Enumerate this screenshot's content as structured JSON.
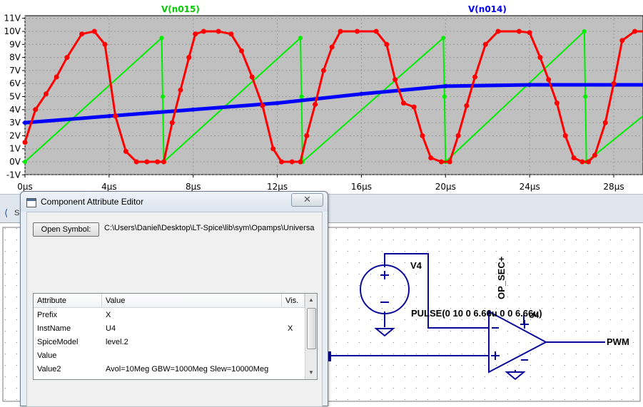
{
  "chart_data": {
    "type": "line",
    "series": [
      {
        "name": "V(n015)",
        "color": "#00ee00",
        "x": [
          0,
          6.5,
          6.55,
          6.6,
          13.1,
          13.15,
          13.2,
          19.9,
          19.95,
          20.0,
          26.6,
          26.65,
          26.7,
          30
        ],
        "y": [
          0,
          9.5,
          5,
          0,
          9.5,
          5,
          0,
          9.5,
          5,
          0,
          10,
          5,
          0,
          4.3
        ]
      },
      {
        "name": "V(n014)",
        "color": "#0000ff",
        "x": [
          0,
          4,
          8,
          12,
          16,
          20,
          24,
          28,
          30
        ],
        "y": [
          3.0,
          3.5,
          4.0,
          4.5,
          5.2,
          5.8,
          5.9,
          5.9,
          5.9
        ]
      },
      {
        "name": "",
        "color": "#ff0000",
        "x": [
          0,
          0.5,
          1.0,
          1.5,
          2.0,
          2.7,
          3.3,
          3.8,
          4.3,
          4.8,
          5.3,
          5.8,
          6.3,
          6.6,
          7.0,
          7.4,
          7.8,
          8.1,
          8.5,
          9.2,
          9.8,
          10.3,
          10.8,
          11.3,
          11.8,
          12.2,
          12.7,
          13.1,
          13.4,
          13.8,
          14.2,
          14.6,
          15.0,
          15.8,
          16.7,
          17.2,
          17.6,
          18.0,
          18.5,
          18.9,
          19.3,
          19.8,
          20.2,
          20.6,
          21.0,
          21.4,
          21.9,
          22.5,
          23.5,
          24.0,
          24.5,
          24.9,
          25.3,
          25.7,
          26.1,
          26.5,
          26.8,
          27.1,
          27.6,
          28.0,
          28.4,
          29.0,
          30
        ],
        "y": [
          1.5,
          4.0,
          5.2,
          6.5,
          8.0,
          9.8,
          10.0,
          9.0,
          3.5,
          0.8,
          0,
          0,
          0,
          0,
          3.0,
          5.5,
          8.0,
          9.8,
          10.0,
          10.0,
          9.8,
          8.5,
          6.5,
          4.3,
          1.0,
          0,
          0,
          0,
          2.0,
          4.4,
          7.0,
          8.8,
          10.0,
          10.0,
          10.0,
          9.0,
          6.3,
          4.5,
          4.2,
          2.0,
          0.3,
          0,
          0,
          2.0,
          4.3,
          6.5,
          9.0,
          10.0,
          10.0,
          9.9,
          8.0,
          6.3,
          4.5,
          2.0,
          0.3,
          0,
          0,
          0.5,
          3.0,
          6.0,
          9.3,
          10.0,
          10.0
        ]
      }
    ],
    "y_ticks": [
      "11V",
      "10V",
      "9V",
      "8V",
      "7V",
      "6V",
      "5V",
      "4V",
      "3V",
      "2V",
      "1V",
      "0V",
      "-1V"
    ],
    "x_ticks": [
      "0µs",
      "4µs",
      "8µs",
      "12µs",
      "16µs",
      "20µs",
      "24µs",
      "28µs"
    ],
    "ylim": [
      -1,
      11
    ],
    "xlim": [
      0,
      30
    ],
    "grid": true,
    "background": "#c0c0c0"
  },
  "dialog": {
    "title": "Component Attribute Editor",
    "close_symbol": "✕",
    "open_symbol_label": "Open Symbol:",
    "symbol_path": "C:\\Users\\Daniel\\Desktop\\LT-Spice\\lib\\sym\\Opamps\\Universa",
    "columns": [
      "Attribute",
      "Value",
      "Vis."
    ],
    "rows": [
      {
        "attribute": "Prefix",
        "value": "X",
        "vis": ""
      },
      {
        "attribute": "InstName",
        "value": "U4",
        "vis": "X"
      },
      {
        "attribute": "SpiceModel",
        "value": "level.2",
        "vis": ""
      },
      {
        "attribute": "Value",
        "value": "",
        "vis": ""
      },
      {
        "attribute": "Value2",
        "value": "Avol=10Meg GBW=1000Meg Slew=10000Meg",
        "vis": ""
      }
    ]
  },
  "schematic": {
    "source_name": "V4",
    "source_value": "PULSE(0 10 0 6.66u 0 0 6.66u)",
    "opamp_name": "U4",
    "supply_net": "OP_SEC+",
    "output_net": "PWM",
    "tab_label": "S"
  }
}
